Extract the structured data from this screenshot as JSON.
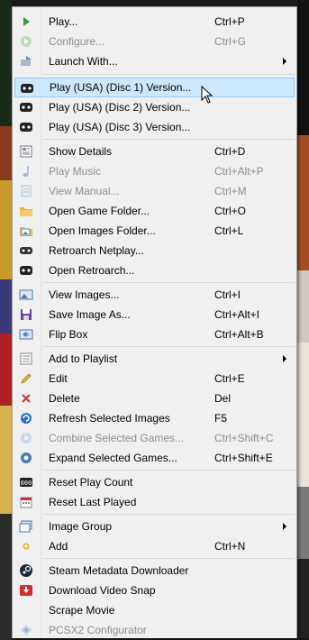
{
  "menu": {
    "items": [
      {
        "label": "Play...",
        "shortcut": "Ctrl+P",
        "icon": "play-icon"
      },
      {
        "label": "Configure...",
        "shortcut": "Ctrl+G",
        "icon": "configure-icon",
        "disabled": true
      },
      {
        "label": "Launch With...",
        "shortcut": "",
        "icon": "launch-with-icon",
        "submenu": true
      },
      {
        "label": "Play (USA) (Disc 1) Version...",
        "shortcut": "",
        "icon": "retroarch-icon",
        "highlighted": true
      },
      {
        "label": "Play (USA) (Disc 2) Version...",
        "shortcut": "",
        "icon": "retroarch-icon"
      },
      {
        "label": "Play (USA) (Disc 3) Version...",
        "shortcut": "",
        "icon": "retroarch-icon"
      },
      {
        "label": "Show Details",
        "shortcut": "Ctrl+D",
        "icon": "details-icon"
      },
      {
        "label": "Play Music",
        "shortcut": "Ctrl+Alt+P",
        "icon": "music-note-icon",
        "disabled": true
      },
      {
        "label": "View Manual...",
        "shortcut": "Ctrl+M",
        "icon": "manual-icon",
        "disabled": true
      },
      {
        "label": "Open Game Folder...",
        "shortcut": "Ctrl+O",
        "icon": "folder-icon"
      },
      {
        "label": "Open Images Folder...",
        "shortcut": "Ctrl+L",
        "icon": "images-folder-icon"
      },
      {
        "label": "Retroarch Netplay...",
        "shortcut": "",
        "icon": "netplay-icon"
      },
      {
        "label": "Open Retroarch...",
        "shortcut": "",
        "icon": "retroarch-icon"
      },
      {
        "label": "View Images...",
        "shortcut": "Ctrl+I",
        "icon": "view-images-icon"
      },
      {
        "label": "Save Image As...",
        "shortcut": "Ctrl+Alt+I",
        "icon": "save-icon"
      },
      {
        "label": "Flip Box",
        "shortcut": "Ctrl+Alt+B",
        "icon": "flip-box-icon"
      },
      {
        "label": "Add to Playlist",
        "shortcut": "",
        "icon": "playlist-icon",
        "submenu": true
      },
      {
        "label": "Edit",
        "shortcut": "Ctrl+E",
        "icon": "pencil-icon"
      },
      {
        "label": "Delete",
        "shortcut": "Del",
        "icon": "delete-x-icon"
      },
      {
        "label": "Refresh Selected Images",
        "shortcut": "F5",
        "icon": "refresh-icon"
      },
      {
        "label": "Combine Selected Games...",
        "shortcut": "Ctrl+Shift+C",
        "icon": "combine-icon",
        "disabled": true
      },
      {
        "label": "Expand Selected Games...",
        "shortcut": "Ctrl+Shift+E",
        "icon": "expand-icon"
      },
      {
        "label": "Reset Play Count",
        "shortcut": "",
        "icon": "counter-icon"
      },
      {
        "label": "Reset Last Played",
        "shortcut": "",
        "icon": "calendar-icon"
      },
      {
        "label": "Image Group",
        "shortcut": "",
        "icon": "image-group-icon",
        "submenu": true
      },
      {
        "label": "Add",
        "shortcut": "Ctrl+N",
        "icon": "add-icon"
      },
      {
        "label": "Steam Metadata Downloader",
        "shortcut": "",
        "icon": "steam-icon"
      },
      {
        "label": "Download Video Snap",
        "shortcut": "",
        "icon": "download-icon"
      },
      {
        "label": "Scrape Movie",
        "shortcut": "",
        "icon": "none"
      },
      {
        "label": "PCSX2 Configurator",
        "shortcut": "",
        "icon": "pcsx2-icon",
        "disabled": true
      }
    ]
  },
  "colors": {
    "menu_bg": "#f0f0f0",
    "highlight_bg": "#cce8ff",
    "highlight_border": "#99c9ef",
    "disabled_text": "#8d8d8d"
  }
}
